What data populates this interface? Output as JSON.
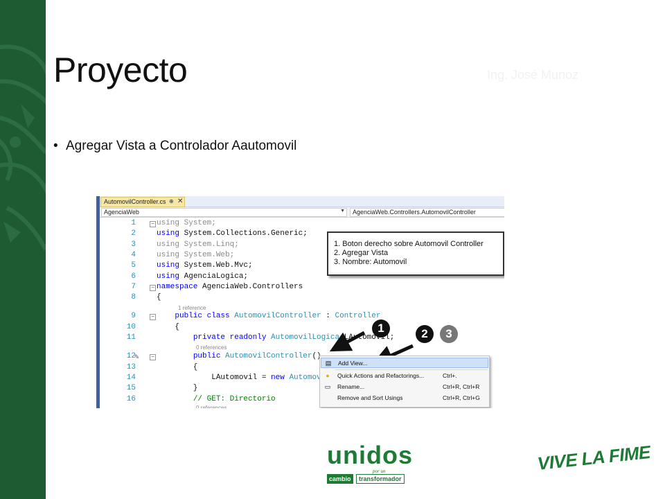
{
  "slide": {
    "title": "Proyecto",
    "author": "Ing. José Munoz",
    "bullet": "Agregar Vista a Controlador Aautomovil",
    "brand_green": "#1e5a32"
  },
  "ide": {
    "tab_label": "AutomovilController.cs",
    "tab_pin": "⊕",
    "tab_close": "✕",
    "nav_project": "AgenciaWeb",
    "nav_class": "AgenciaWeb.Controllers.AutomovilController",
    "lines": [
      {
        "n": "1",
        "parts": [
          [
            "gr",
            "using System;"
          ]
        ]
      },
      {
        "n": "2",
        "parts": [
          [
            "kw",
            "using"
          ],
          [
            "",
            " System.Collections.Generic;"
          ]
        ]
      },
      {
        "n": "3",
        "parts": [
          [
            "gr",
            "using System.Linq;"
          ]
        ]
      },
      {
        "n": "4",
        "parts": [
          [
            "gr",
            "using System.Web;"
          ]
        ]
      },
      {
        "n": "5",
        "parts": [
          [
            "kw",
            "using"
          ],
          [
            "",
            " System.Web.Mvc;"
          ]
        ]
      },
      {
        "n": "6",
        "parts": [
          [
            "kw",
            "using"
          ],
          [
            "",
            " AgenciaLogica;"
          ]
        ]
      },
      {
        "n": "7",
        "parts": [
          [
            "kw",
            "namespace"
          ],
          [
            "",
            " AgenciaWeb.Controllers"
          ]
        ]
      },
      {
        "n": "8",
        "parts": [
          [
            "",
            "{"
          ]
        ]
      },
      {
        "n": "9",
        "parts": [
          [
            "",
            "    "
          ],
          [
            "kw",
            "public class"
          ],
          [
            "",
            " "
          ],
          [
            "ty",
            "AutomovilController"
          ],
          [
            "",
            " : "
          ],
          [
            "ty",
            "Controller"
          ]
        ]
      },
      {
        "n": "10",
        "parts": [
          [
            "",
            "    {"
          ]
        ]
      },
      {
        "n": "11",
        "parts": [
          [
            "",
            "        "
          ],
          [
            "kw",
            "private readonly"
          ],
          [
            "",
            " "
          ],
          [
            "ty",
            "AutomovilLogica"
          ],
          [
            "",
            " LAutomovil;"
          ]
        ]
      },
      {
        "n": "12",
        "parts": [
          [
            "",
            "        "
          ],
          [
            "kw",
            "public"
          ],
          [
            "",
            " "
          ],
          [
            "ty",
            "AutomovilController"
          ],
          [
            "",
            "()"
          ]
        ]
      },
      {
        "n": "13",
        "parts": [
          [
            "",
            "        {"
          ]
        ]
      },
      {
        "n": "14",
        "parts": [
          [
            "",
            "            LAutomovil = "
          ],
          [
            "kw",
            "new"
          ],
          [
            "",
            " "
          ],
          [
            "ty",
            "Automov"
          ]
        ]
      },
      {
        "n": "15",
        "parts": [
          [
            "",
            "        }"
          ]
        ]
      },
      {
        "n": "16",
        "parts": [
          [
            "",
            "        "
          ],
          [
            "cm",
            "// GET: Directorio"
          ]
        ]
      }
    ],
    "refs": {
      "class_ref": "1 reference",
      "ctor_ref": "0 references",
      "method_ref": "0 references"
    },
    "callout": [
      "1. Boton derecho sobre Automovil Controller",
      "2. Agregar Vista",
      "3. Nombre: Automovil"
    ],
    "steps": [
      "1",
      "2",
      "3"
    ],
    "context_menu": [
      {
        "icon": "add-view",
        "label": "Add View...",
        "shortcut": "",
        "highlighted": true
      },
      {
        "icon": "lightbulb",
        "label": "Quick Actions and Refactorings...",
        "shortcut": "Ctrl+.",
        "highlighted": false
      },
      {
        "icon": "rename",
        "label": "Rename...",
        "shortcut": "Ctrl+R, Ctrl+R",
        "highlighted": false
      },
      {
        "icon": "",
        "label": "Remove and Sort Usings",
        "shortcut": "Ctrl+R, Ctrl+G",
        "highlighted": false
      }
    ]
  },
  "logos": {
    "unidos": "unidos",
    "por_un": "por un",
    "cambio": "cambio",
    "transformador": "transformador",
    "vive": "VIVE LA FIME"
  }
}
